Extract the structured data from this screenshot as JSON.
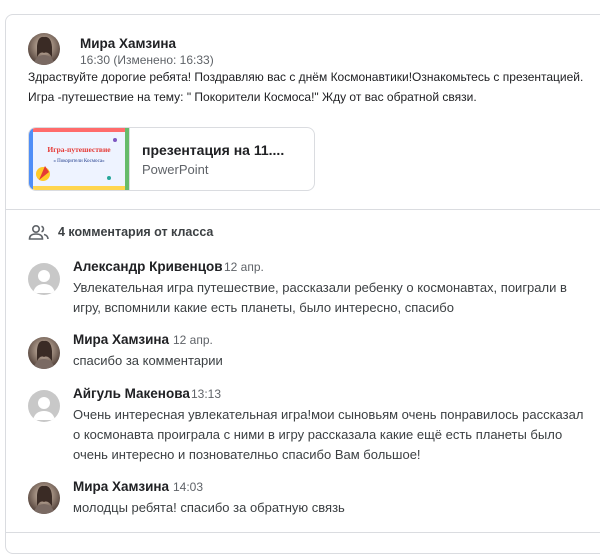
{
  "post": {
    "author": "Мира Хамзина",
    "timestamp": "16:30 (Изменено: 16:33)",
    "text_line1": "Здраствуйте дорогие ребята! Поздравляю вас с днём Космонавтики!Ознакомьтесь с презентацией.",
    "text_line2": "Игра -путешествие на тему: \" Покорители Космоса!\" Жду от вас обратной связи.",
    "attachment": {
      "title": "презентация на 11....",
      "type": "PowerPoint",
      "thumb_title": "Игра-путешествие",
      "thumb_subtitle": "« Покорители Космоса»"
    }
  },
  "comments_header": {
    "icon": "people-icon",
    "label": "4 комментария от класса"
  },
  "comments": [
    {
      "author": "Александр Кривенцов",
      "time": "12 апр.",
      "avatar": "default",
      "line1": "Увлекательная игра путешествие, рассказали ребенку о космонавтах, поиграли в",
      "line2": "игру, вспомнили какие есть планеты, было интересно, спасибо"
    },
    {
      "author": "Мира Хамзина",
      "time": "12 апр.",
      "avatar": "photo",
      "line1": "спасибо за комментарии"
    },
    {
      "author": "Айгуль Макенова",
      "time": "13:13",
      "avatar": "default",
      "line1": "Очень интересная увлекательная игра!мои сыновьям очень понравилось рассказал",
      "line2": "о космонавта проиграла с ними в игру рассказала какие ещё есть планеты было",
      "line3": "очень интересно и познователньо спасибо Вам большое!"
    },
    {
      "author": "Мира Хамзина",
      "time": "14:03",
      "avatar": "photo",
      "line1": "молодцы ребята! спасибо за обратную связь"
    }
  ],
  "colors": {
    "border": "#dadce0",
    "text_primary": "#202124",
    "text_secondary": "#5f6368",
    "avatar_default": "#c8c8c8"
  }
}
